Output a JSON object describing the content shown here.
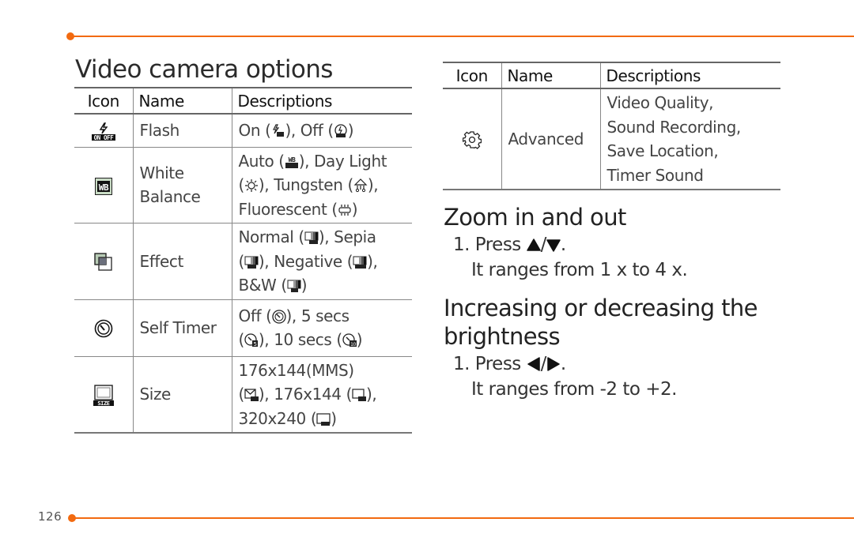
{
  "page": {
    "number": "126",
    "accent_color": "#f26a10"
  },
  "video_options": {
    "title": "Video camera options",
    "headers": {
      "icon": "Icon",
      "name": "Name",
      "descriptions": "Descriptions"
    },
    "rows": [
      {
        "icon": "flash-icon",
        "name": "Flash",
        "desc": [
          {
            "text": "On (",
            "icon": "flash-on-icon",
            "after": "), Off ("
          },
          {
            "icon": "flash-off-icon",
            "after": ")"
          }
        ]
      },
      {
        "icon": "white-balance-icon",
        "name": "White Balance",
        "desc_lines": [
          "Auto (",
          "), Day Light",
          "(",
          "), Tungsten (",
          "),",
          "Fluorescent (",
          ")"
        ],
        "desc_icons": [
          "wb-auto-icon",
          "wb-daylight-icon",
          "wb-tungsten-icon",
          "wb-fluorescent-icon"
        ]
      },
      {
        "icon": "effect-icon",
        "name": "Effect",
        "desc_lines": [
          "Normal (",
          "), Sepia",
          "(",
          "), Negative (",
          "),",
          "B&W (",
          ")"
        ],
        "desc_icons": [
          "effect-normal-icon",
          "effect-sepia-icon",
          "effect-negative-icon",
          "effect-bw-icon"
        ]
      },
      {
        "icon": "self-timer-icon",
        "name": "Self Timer",
        "desc_lines": [
          "Off (",
          "), 5 secs",
          "(",
          "), 10 secs (",
          ")"
        ],
        "desc_icons": [
          "timer-off-icon",
          "timer-5-icon",
          "timer-10-icon"
        ]
      },
      {
        "icon": "size-icon",
        "name": "Size",
        "desc_lines": [
          "176x144(MMS)",
          "(",
          "), 176x144 (",
          "),",
          "320x240 (",
          ")"
        ],
        "desc_icons": [
          "size-mms-icon",
          "size-176-icon",
          "size-320-icon"
        ]
      }
    ],
    "text": {
      "flash_on": "On (",
      "flash_mid": "), Off (",
      "close": ")",
      "wb_1": "Auto (",
      "wb_2": "), Day Light",
      "open": "(",
      "wb_3": "), Tungsten (",
      "close_comma": "),",
      "wb_4": "Fluorescent (",
      "eff_1": "Normal (",
      "eff_2": "), Sepia",
      "eff_3": "), Negative (",
      "eff_4": "B&W (",
      "tim_1": "Off (",
      "tim_2": "), 5 secs",
      "tim_3": "), 10 secs (",
      "size_1": "176x144(MMS)",
      "size_2": "), 176x144 (",
      "size_3": "320x240 (",
      "name_wb_1": "White",
      "name_wb_2": "Balance"
    }
  },
  "advanced_table": {
    "headers": {
      "icon": "Icon",
      "name": "Name",
      "descriptions": "Descriptions"
    },
    "row": {
      "icon": "settings-gear-icon",
      "name": "Advanced",
      "desc": [
        "Video Quality,",
        "Sound Recording,",
        "Save Location,",
        "Timer Sound"
      ]
    }
  },
  "zoom_section": {
    "title": "Zoom in and out",
    "step_prefix": "1. Press ",
    "keys": [
      "up-arrow-icon",
      "down-arrow-icon"
    ],
    "separator": "/",
    "step_suffix": ".",
    "note": "It ranges from 1 x to 4 x."
  },
  "brightness_section": {
    "title": "Increasing or decreasing the brightness",
    "step_prefix": "1. Press ",
    "keys": [
      "left-arrow-icon",
      "right-arrow-icon"
    ],
    "separator": "/",
    "step_suffix": ".",
    "note": "It ranges from -2 to +2."
  }
}
